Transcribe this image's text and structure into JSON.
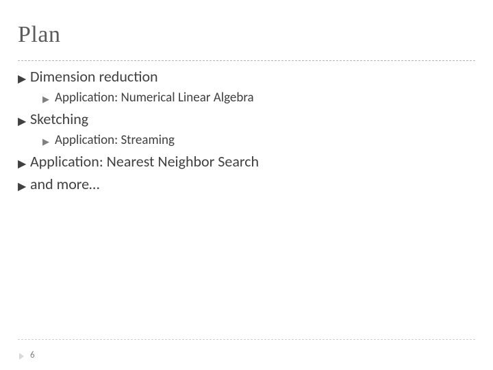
{
  "title": "Plan",
  "items": [
    {
      "label": "Dimension reduction",
      "children": [
        {
          "label": "Application: Numerical Linear Algebra"
        }
      ]
    },
    {
      "label": "Sketching",
      "children": [
        {
          "label": "Application: Streaming"
        }
      ]
    },
    {
      "label": "Application: Nearest Neighbor Search"
    },
    {
      "label": "and more…"
    }
  ],
  "page_number": "6"
}
